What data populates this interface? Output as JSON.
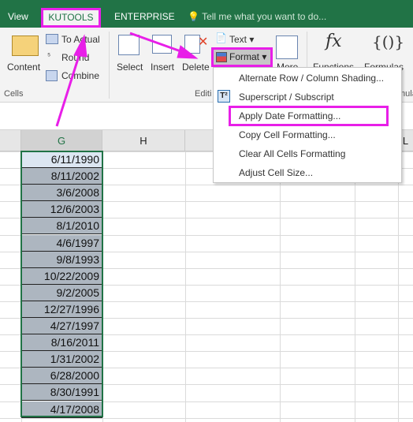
{
  "tabs": {
    "view": "View",
    "kutools": "KUTOOLS",
    "enterprise": "ENTERPRISE",
    "tell_me": "Tell me what you want to do..."
  },
  "ribbon": {
    "content": "Content",
    "to_actual": "To Actual",
    "round": "Round",
    "combine": "Combine",
    "select": "Select",
    "insert": "Insert",
    "delete": "Delete",
    "text": "Text",
    "format": "Format",
    "more": "More",
    "functions": "Functions",
    "formulas": "Formulas",
    "groups": {
      "cells": "Cells",
      "editing": "Editi",
      "formula": "mula"
    }
  },
  "menu": {
    "items": [
      "Alternate Row / Column Shading...",
      "Superscript / Subscript",
      "Apply Date Formatting...",
      "Copy Cell Formatting...",
      "Clear All Cells Formatting",
      "Adjust Cell Size..."
    ],
    "highlighted": "Apply Date Formatting..."
  },
  "columns": [
    "G",
    "H",
    "L"
  ],
  "cells_g": [
    "6/11/1990",
    "8/11/2002",
    "3/6/2008",
    "12/6/2003",
    "8/1/2010",
    "4/6/1997",
    "9/8/1993",
    "10/22/2009",
    "9/2/2005",
    "12/27/1996",
    "4/27/1997",
    "8/16/2011",
    "1/31/2002",
    "6/28/2000",
    "8/30/1991",
    "4/17/2008"
  ],
  "colors": {
    "excel_green": "#217346",
    "highlight": "#e81fe8",
    "selection_fill": "#adb6c0",
    "active_cell": "#dce6f1"
  }
}
